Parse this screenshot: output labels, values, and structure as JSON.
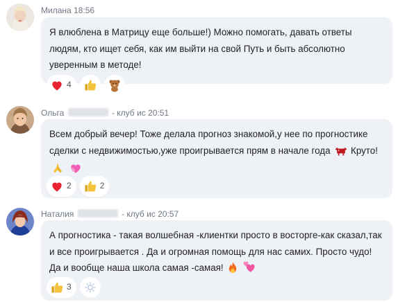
{
  "messages": [
    {
      "author": "Милана",
      "author_suffix": "",
      "time": "18:56",
      "text": "Я влюблена в Матрицу еще больше!) Можно помогать, давать ответы людям, кто ищет себя, как им выйти на свой Путь и быть абсолютно уверенным в методе!",
      "reactions": [
        {
          "icon": "heart-icon",
          "count": "4"
        },
        {
          "icon": "thumbs-up-icon",
          "count": ""
        },
        {
          "icon": "teddy-bear-icon",
          "count": ""
        }
      ]
    },
    {
      "author": "Ольга",
      "author_suffix": "- клуб ис",
      "time": "20:51",
      "text": "Всем добрый вечер! Тоже делала прогноз знакомой,у нее по прогностике сделки с недвижимостью,уже проигрывается прям в начале года",
      "text_after": "Круто!",
      "reactions": [
        {
          "icon": "heart-icon",
          "count": "2"
        },
        {
          "icon": "thumbs-up-icon",
          "count": "2"
        }
      ]
    },
    {
      "author": "Наталия",
      "author_suffix": "- клуб ис",
      "time": "20:57",
      "text": "А прогностика - такая волшебная -клиентки просто в восторге-как сказал,так и все проигрывается . Да и огромная помощь для нас самих. Просто чудо! Да и вообще наша школа самая -самая!",
      "reactions": [
        {
          "icon": "thumbs-up-icon",
          "count": "3"
        },
        {
          "icon": "sparkle-icon",
          "count": ""
        }
      ]
    }
  ],
  "colors": {
    "bubble": "#eef1f6",
    "header_text": "#6f7785",
    "heart": "#e8232f"
  }
}
